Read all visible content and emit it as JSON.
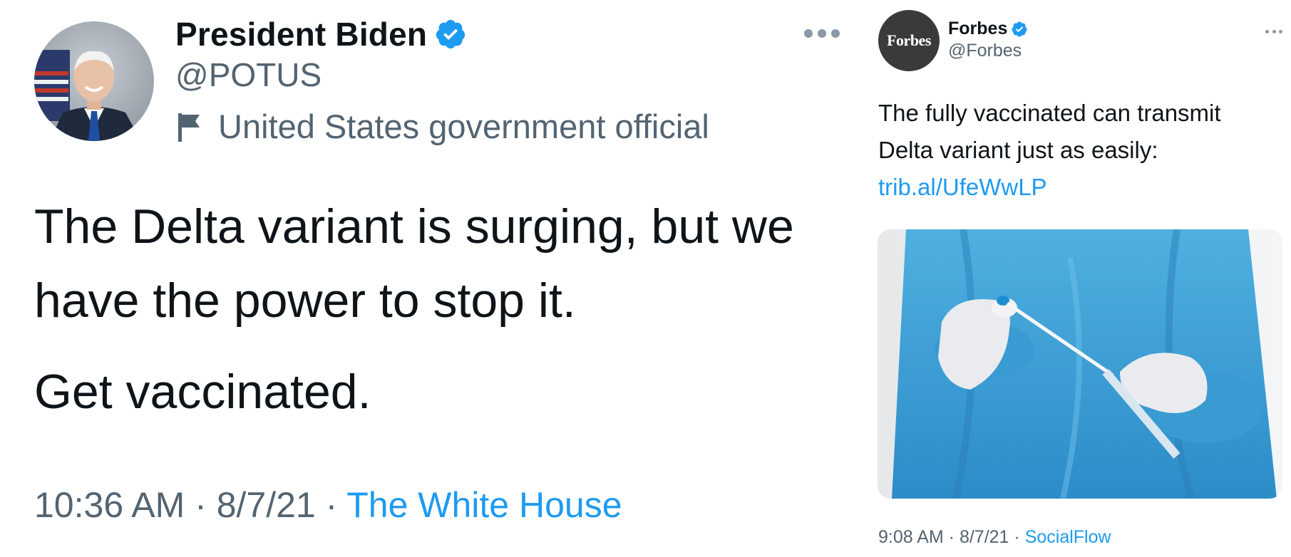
{
  "left_tweet": {
    "author_name": "President Biden",
    "handle": "@POTUS",
    "account_label": "United States government official",
    "verified_icon": "verified-badge-icon",
    "label_icon": "flag-icon",
    "more_icon": "more-options-icon",
    "text_para1": "The Delta variant is surging, but we have the power to stop it.",
    "text_para2": "Get vaccinated.",
    "time": "10:36 AM",
    "separator": " · ",
    "date": "8/7/21",
    "source": "The White House"
  },
  "right_tweet": {
    "author_name": "Forbes",
    "handle": "@Forbes",
    "avatar_text": "Forbes",
    "verified_icon": "verified-badge-icon",
    "more_icon": "more-options-icon",
    "text": "The fully vaccinated can transmit Delta variant just as easily:",
    "link": "trib.al/UfeWwLP",
    "media": "photo-gloved-hands-holding-swab-test",
    "time": "9:08 AM",
    "separator": " · ",
    "date": "8/7/21",
    "source": "SocialFlow"
  },
  "colors": {
    "text_primary": "#0f1419",
    "text_secondary": "#536471",
    "link": "#1d9bf0",
    "verified": "#1d9bf0"
  }
}
